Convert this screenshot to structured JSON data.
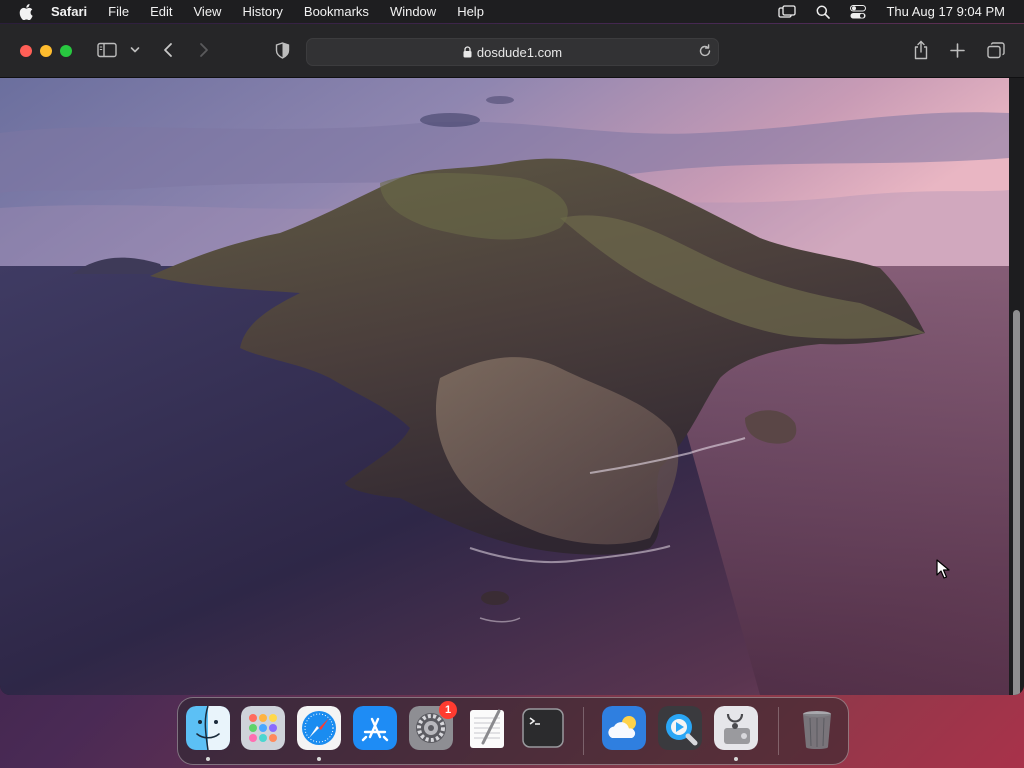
{
  "menubar": {
    "app_name": "Safari",
    "items": [
      "File",
      "Edit",
      "View",
      "History",
      "Bookmarks",
      "Window",
      "Help"
    ],
    "clock": "Thu Aug 17  9:04 PM",
    "status_icons": [
      "screen-mirroring-icon",
      "spotlight-search-icon",
      "control-center-icon"
    ]
  },
  "safari": {
    "url": "dosdude1.com",
    "toolbar_icons": [
      "sidebar-icon",
      "chevron-down-icon",
      "back-icon",
      "forward-icon",
      "privacy-shield-icon",
      "lock-icon",
      "reload-icon",
      "share-icon",
      "new-tab-icon",
      "tab-overview-icon"
    ]
  },
  "content": {
    "wallpaper": "macOS Catalina island at dusk"
  },
  "dock": {
    "apps": [
      "Finder",
      "Launchpad",
      "Safari",
      "App Store",
      "System Preferences",
      "TextEdit",
      "Terminal",
      "Weather",
      "QuickTime Player",
      "Disk Utility",
      "Trash"
    ],
    "badge_count": "1"
  },
  "colors": {
    "menubar_bg": "#1e1e20",
    "toolbar_bg": "#262628",
    "close": "#ff5f57",
    "minimize": "#febc2e",
    "zoom": "#28c840",
    "badge": "#ff3b30"
  }
}
